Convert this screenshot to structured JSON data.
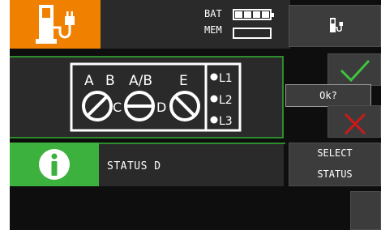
{
  "header": {
    "bat_label": "BAT",
    "mem_label": "MEM",
    "battery_level": 4,
    "battery_cells": 4,
    "icon": "ev-charging-station-icon"
  },
  "buttons": {
    "charger_icon": "charger-plug-icon",
    "ok_icon": "checkmark-icon",
    "cancel_icon": "cross-icon",
    "ok_popup": "Ok?",
    "select_status_line1": "SELECT",
    "select_status_line2": "STATUS"
  },
  "diagram": {
    "switch_labels": [
      "A",
      "B",
      "A/B",
      "E"
    ],
    "middle_labels": [
      "C",
      "D"
    ],
    "phase_labels": [
      "L1",
      "L2",
      "L3"
    ]
  },
  "status": {
    "icon": "info-icon",
    "text": "STATUS D"
  },
  "colors": {
    "accent_orange": "#f08000",
    "accent_green": "#3db13d",
    "ok_green": "#3ec43e",
    "cancel_red": "#d01818",
    "panel": "#2a2a2a",
    "button": "#3c3c3c"
  }
}
